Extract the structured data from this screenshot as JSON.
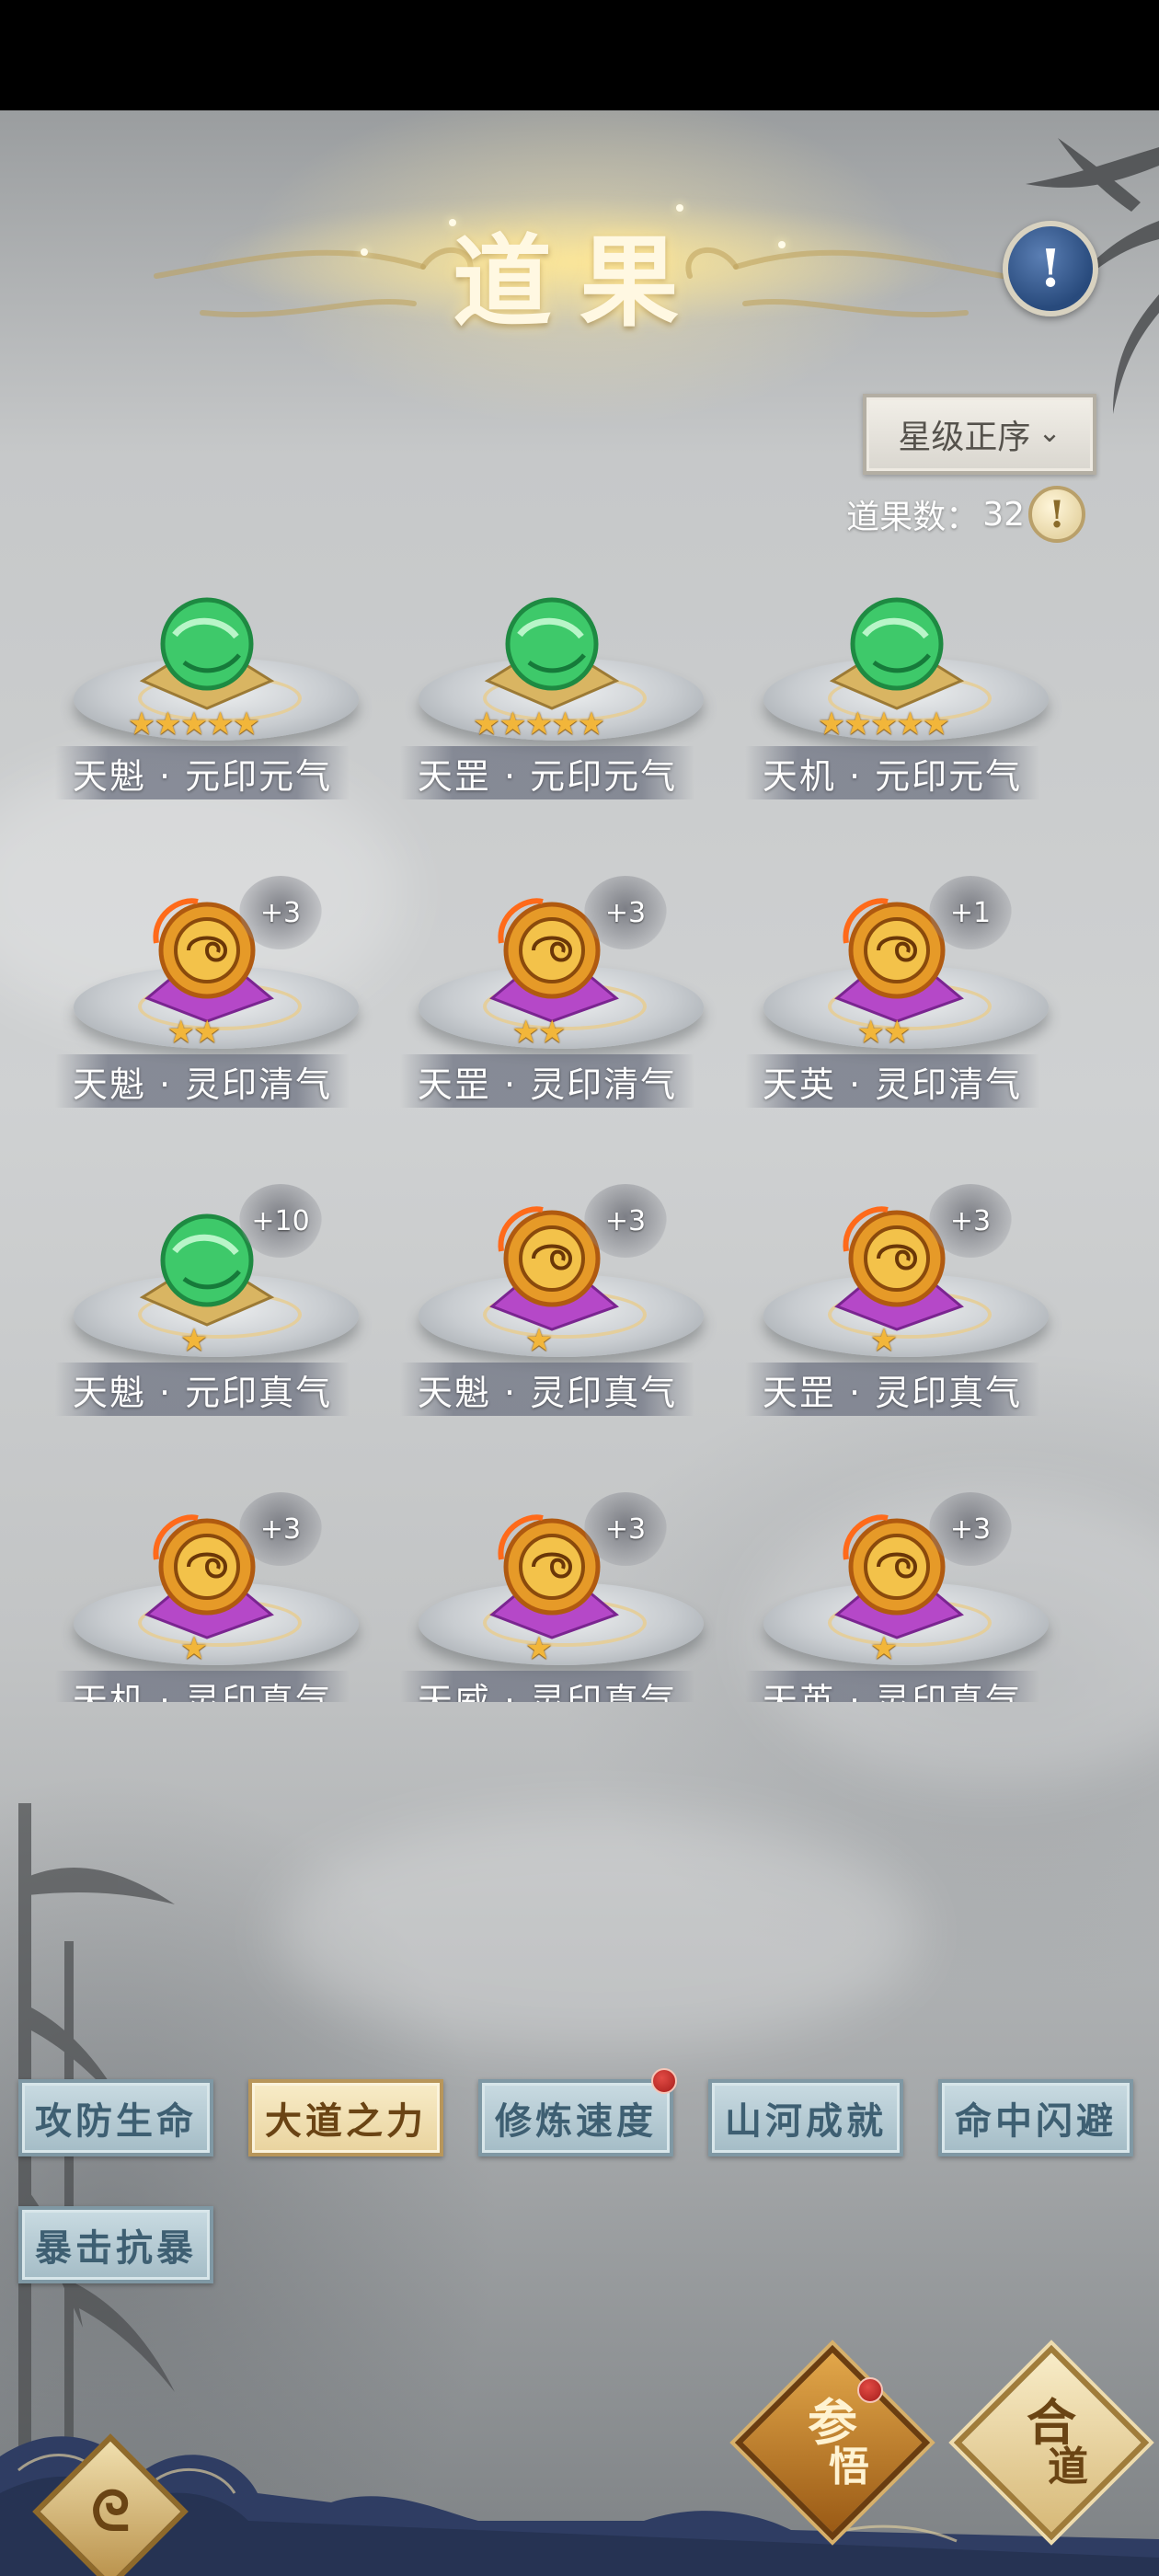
{
  "header": {
    "title": "道果",
    "info_icon": "exclamation-icon",
    "sort_label": "星级正序",
    "count_label": "道果数：",
    "count_value": "32"
  },
  "items": [
    {
      "name": "天魁 · 元印元气",
      "stars": "★★★★★",
      "plus": "",
      "gem": "green"
    },
    {
      "name": "天罡 · 元印元气",
      "stars": "★★★★★",
      "plus": "",
      "gem": "green"
    },
    {
      "name": "天机 · 元印元气",
      "stars": "★★★★★",
      "plus": "",
      "gem": "green"
    },
    {
      "name": "天魁 · 灵印清气",
      "stars": "★★",
      "plus": "+3",
      "gem": "gold"
    },
    {
      "name": "天罡 · 灵印清气",
      "stars": "★★",
      "plus": "+3",
      "gem": "gold"
    },
    {
      "name": "天英 · 灵印清气",
      "stars": "★★",
      "plus": "+1",
      "gem": "gold"
    },
    {
      "name": "天魁 · 元印真气",
      "stars": "★",
      "plus": "+10",
      "gem": "green"
    },
    {
      "name": "天魁 · 灵印真气",
      "stars": "★",
      "plus": "+3",
      "gem": "gold"
    },
    {
      "name": "天罡 · 灵印真气",
      "stars": "★",
      "plus": "+3",
      "gem": "gold"
    },
    {
      "name": "天机 · 灵印真气",
      "stars": "★",
      "plus": "+3",
      "gem": "gold"
    },
    {
      "name": "天威 · 灵印真气",
      "stars": "★",
      "plus": "+3",
      "gem": "gold"
    },
    {
      "name": "天英 · 灵印真气",
      "stars": "★",
      "plus": "+3",
      "gem": "gold"
    }
  ],
  "tabs": [
    {
      "label": "攻防生命",
      "active": false,
      "dot": false
    },
    {
      "label": "大道之力",
      "active": true,
      "dot": false
    },
    {
      "label": "修炼速度",
      "active": false,
      "dot": true
    },
    {
      "label": "山河成就",
      "active": false,
      "dot": false
    },
    {
      "label": "命中闪避",
      "active": false,
      "dot": false
    },
    {
      "label": "暴击抗暴",
      "active": false,
      "dot": false
    }
  ],
  "bottom": {
    "back_icon": "swirl-back-icon",
    "canwu_top": "参",
    "canwu_bottom": "悟",
    "hedao_top": "合",
    "hedao_bottom": "道"
  },
  "colors": {
    "star": "#f2b63a",
    "tab_active": "#e9d39e",
    "tab_inactive": "#a4bcc6",
    "notice_dot": "#c22a25"
  }
}
